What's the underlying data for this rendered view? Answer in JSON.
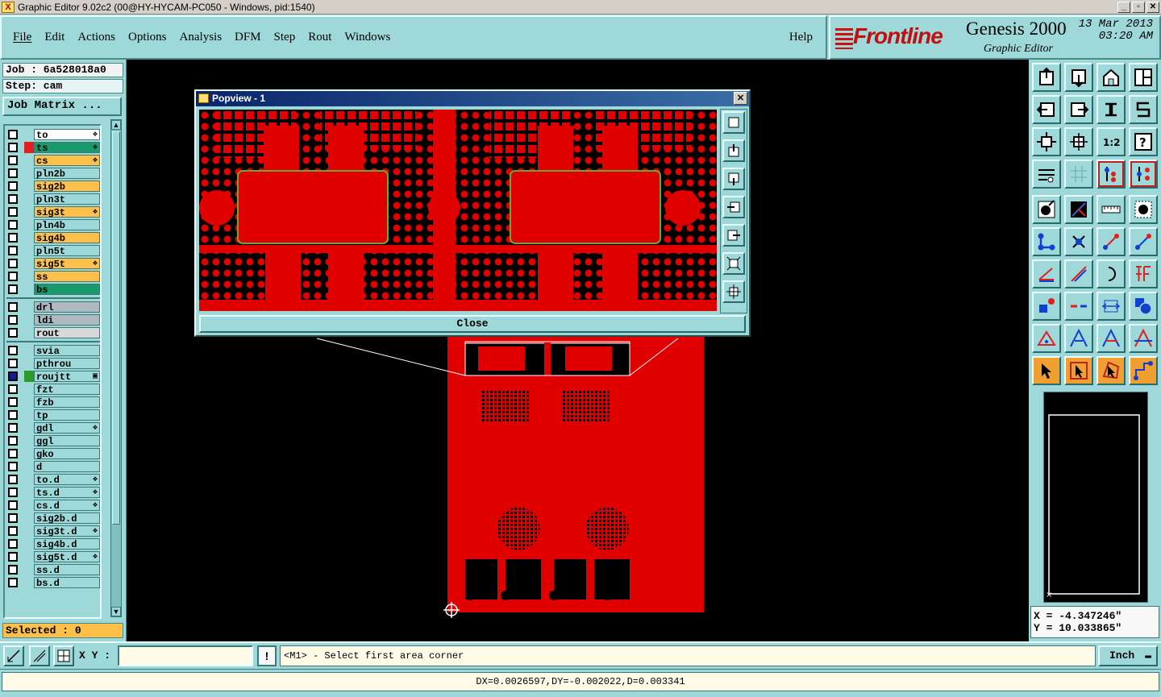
{
  "window": {
    "title": "Graphic Editor 9.02c2 (00@HY-HYCAM-PC050 - Windows, pid:1540)",
    "buttons": [
      "_",
      "▫",
      "✕"
    ]
  },
  "menu": {
    "items": [
      "File",
      "Edit",
      "Actions",
      "Options",
      "Analysis",
      "DFM",
      "Step",
      "Rout",
      "Windows"
    ],
    "help": "Help"
  },
  "brand": {
    "logo": "Frontline",
    "product": "Genesis 2000",
    "subtitle": "Graphic Editor",
    "date": "13 Mar 2013",
    "time": "03:20 AM"
  },
  "job": {
    "job_label": "Job : 6a528018a0",
    "step_label": "Step: cam",
    "matrix_button": "Job Matrix ..."
  },
  "layers": [
    {
      "name": "to",
      "bg": "#ffffff",
      "color": "",
      "mark": "❖"
    },
    {
      "name": "ts",
      "bg": "#1a9a6a",
      "color": "#e02020",
      "mark": "❖"
    },
    {
      "name": "cs",
      "bg": "#ffc04a",
      "color": "",
      "mark": "❖"
    },
    {
      "name": "pln2b",
      "bg": "#9fd8d8",
      "color": "",
      "mark": ""
    },
    {
      "name": "sig2b",
      "bg": "#ffc04a",
      "color": "",
      "mark": ""
    },
    {
      "name": "pln3t",
      "bg": "#9fd8d8",
      "color": "",
      "mark": ""
    },
    {
      "name": "sig3t",
      "bg": "#ffc04a",
      "color": "",
      "mark": "❖"
    },
    {
      "name": "pln4b",
      "bg": "#9fd8d8",
      "color": "",
      "mark": ""
    },
    {
      "name": "sig4b",
      "bg": "#ffc04a",
      "color": "",
      "mark": ""
    },
    {
      "name": "pln5t",
      "bg": "#9fd8d8",
      "color": "",
      "mark": ""
    },
    {
      "name": "sig5t",
      "bg": "#ffc04a",
      "color": "",
      "mark": "❖"
    },
    {
      "name": "ss",
      "bg": "#ffc04a",
      "color": "",
      "mark": ""
    },
    {
      "name": "bs",
      "bg": "#1a9a6a",
      "color": "",
      "mark": ""
    },
    {
      "name": "drl",
      "bg": "#b0b8c0",
      "color": "",
      "mark": ""
    },
    {
      "name": "ldi",
      "bg": "#b0b8c0",
      "color": "",
      "mark": ""
    },
    {
      "name": "rout",
      "bg": "#d8d8d8",
      "color": "",
      "mark": ""
    },
    {
      "name": "svia",
      "bg": "#9fd8d8",
      "color": "",
      "mark": ""
    },
    {
      "name": "pthrou",
      "bg": "#9fd8d8",
      "color": "",
      "mark": ""
    },
    {
      "name": "roujtt",
      "bg": "#9fd8d8",
      "color": "#2a9a2a",
      "mark": "▣"
    },
    {
      "name": "fzt",
      "bg": "#9fd8d8",
      "color": "",
      "mark": ""
    },
    {
      "name": "fzb",
      "bg": "#9fd8d8",
      "color": "",
      "mark": ""
    },
    {
      "name": "tp",
      "bg": "#9fd8d8",
      "color": "",
      "mark": ""
    },
    {
      "name": "gdl",
      "bg": "#9fd8d8",
      "color": "",
      "mark": "❖"
    },
    {
      "name": "ggl",
      "bg": "#9fd8d8",
      "color": "",
      "mark": ""
    },
    {
      "name": "gko",
      "bg": "#9fd8d8",
      "color": "",
      "mark": ""
    },
    {
      "name": "d",
      "bg": "#9fd8d8",
      "color": "",
      "mark": ""
    },
    {
      "name": "to.d",
      "bg": "#9fd8d8",
      "color": "",
      "mark": "❖"
    },
    {
      "name": "ts.d",
      "bg": "#9fd8d8",
      "color": "",
      "mark": "❖"
    },
    {
      "name": "cs.d",
      "bg": "#9fd8d8",
      "color": "",
      "mark": "❖"
    },
    {
      "name": "sig2b.d",
      "bg": "#9fd8d8",
      "color": "",
      "mark": ""
    },
    {
      "name": "sig3t.d",
      "bg": "#9fd8d8",
      "color": "",
      "mark": "❖"
    },
    {
      "name": "sig4b.d",
      "bg": "#9fd8d8",
      "color": "",
      "mark": ""
    },
    {
      "name": "sig5t.d",
      "bg": "#9fd8d8",
      "color": "",
      "mark": "❖"
    },
    {
      "name": "ss.d",
      "bg": "#9fd8d8",
      "color": "",
      "mark": ""
    },
    {
      "name": "bs.d",
      "bg": "#9fd8d8",
      "color": "",
      "mark": ""
    }
  ],
  "selected": "Selected : 0",
  "popview": {
    "title": "Popview - 1",
    "close_label": "Close"
  },
  "bottom": {
    "xy_label": "X Y :",
    "xy_value": "",
    "excl": "!",
    "prompt": "<M1> - Select first area corner",
    "units": "Inch"
  },
  "coords": {
    "x": "X = -4.347246\"",
    "y": "Y = 10.033865\""
  },
  "measure": "DX=0.0026597,DY=-0.002022,D=0.003341",
  "colors": {
    "panel": "#9fd8d8",
    "copper": "#e00000",
    "highlight": "#ffc04a"
  }
}
